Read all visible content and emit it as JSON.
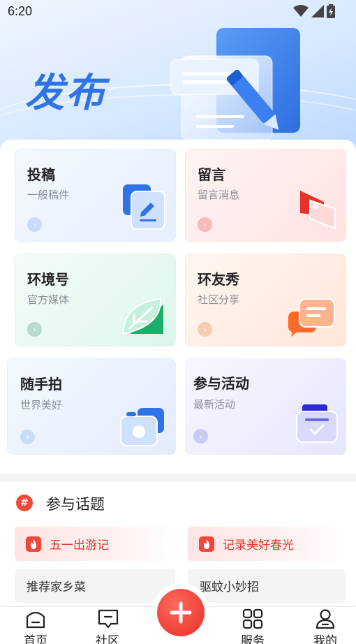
{
  "status_bar": {
    "time": "6:20"
  },
  "hero": {
    "title": "发布"
  },
  "cards": [
    {
      "title": "投稿",
      "subtitle": "一般稿件"
    },
    {
      "title": "留言",
      "subtitle": "留言消息"
    },
    {
      "title": "环境号",
      "subtitle": "官方媒体"
    },
    {
      "title": "环友秀",
      "subtitle": "社区分享"
    },
    {
      "title": "随手拍",
      "subtitle": "世界美好"
    },
    {
      "title": "参与活动",
      "subtitle": "最新活动"
    }
  ],
  "topics": {
    "heading": "参与话题",
    "heading_icon": "#",
    "hot": [
      "五一出游记",
      "记录美好春光"
    ],
    "plain": [
      "推荐家乡菜",
      "驱蚊小妙招"
    ]
  },
  "nav": {
    "items": [
      {
        "label": "首页",
        "icon": "home-icon"
      },
      {
        "label": "社区",
        "icon": "community-icon"
      },
      {
        "label": "服务",
        "icon": "grid-icon"
      },
      {
        "label": "我的",
        "icon": "profile-icon"
      }
    ],
    "fab_icon": "plus-icon"
  },
  "colors": {
    "accent_blue": "#2f74e6",
    "accent_red": "#e8322a",
    "card_blue": "#eef4ff",
    "card_pink": "#ffecec",
    "card_green": "#e6f8ef",
    "card_orange": "#fff0e8",
    "card_purple": "#eeeeff"
  }
}
